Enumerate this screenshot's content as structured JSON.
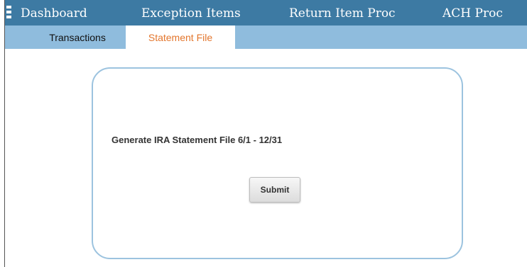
{
  "top_nav": {
    "menu_icon": "hamburger-menu-icon",
    "items": [
      {
        "label": "Dashboard"
      },
      {
        "label": "Exception Items"
      },
      {
        "label": "Return Item Proc"
      },
      {
        "label": "ACH Proc"
      }
    ]
  },
  "sub_nav": {
    "tabs": [
      {
        "label": "Transactions",
        "active": false
      },
      {
        "label": "Statement File",
        "active": true
      }
    ]
  },
  "main": {
    "label": "Generate IRA Statement File 6/1 - 12/31",
    "submit_label": "Submit"
  },
  "colors": {
    "nav_bg": "#3d7aa3",
    "subnav_bg": "#8fbcdd",
    "active_tab_text": "#e3762d",
    "card_border": "#9cc3df"
  }
}
